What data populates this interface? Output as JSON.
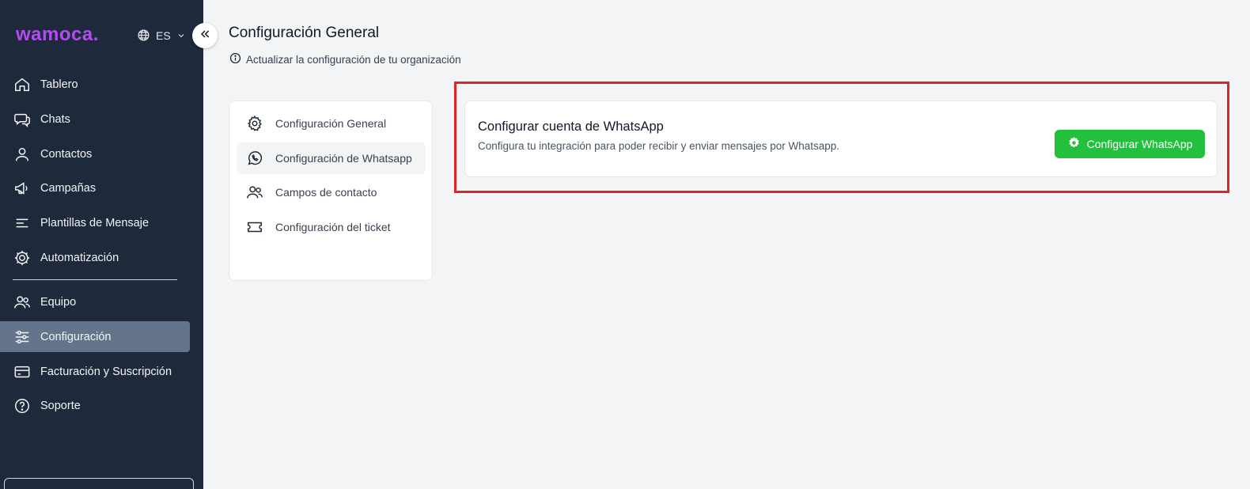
{
  "brand": {
    "logo_text": "wamoca."
  },
  "language": {
    "current": "ES"
  },
  "sidebar": {
    "items": [
      {
        "label": "Tablero",
        "icon": "home-icon"
      },
      {
        "label": "Chats",
        "icon": "chat-bubbles-icon"
      },
      {
        "label": "Contactos",
        "icon": "user-icon"
      },
      {
        "label": "Campañas",
        "icon": "megaphone-icon"
      },
      {
        "label": "Plantillas de Mensaje",
        "icon": "text-lines-icon"
      },
      {
        "label": "Automatización",
        "icon": "cog-icon"
      },
      {
        "label": "Equipo",
        "icon": "users-icon"
      },
      {
        "label": "Configuración",
        "icon": "sliders-icon",
        "active": true
      },
      {
        "label": "Facturación y Suscripción",
        "icon": "credit-card-icon"
      },
      {
        "label": "Soporte",
        "icon": "help-circle-icon"
      }
    ]
  },
  "page": {
    "title": "Configuración General",
    "subtitle": "Actualizar la configuración de tu organización"
  },
  "settings_nav": {
    "items": [
      {
        "label": "Configuración General",
        "icon": "gear-icon"
      },
      {
        "label": "Configuración de Whatsapp",
        "icon": "whatsapp-icon",
        "active": true
      },
      {
        "label": "Campos de contacto",
        "icon": "users-icon"
      },
      {
        "label": "Configuración del ticket",
        "icon": "ticket-icon"
      }
    ]
  },
  "whatsapp_card": {
    "title": "Configurar cuenta de WhatsApp",
    "description": "Configura tu integración para poder recibir y enviar mensajes por Whatsapp.",
    "button_label": "Configurar WhatsApp"
  },
  "colors": {
    "sidebar_bg": "#1e293b",
    "sidebar_active": "#64748b",
    "brand": "#b14cf0",
    "button_green": "#22c03c",
    "highlight_red": "#dc2626",
    "page_bg": "#f3f4f6"
  }
}
